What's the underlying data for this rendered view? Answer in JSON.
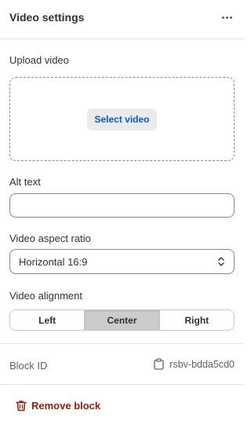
{
  "header": {
    "title": "Video settings",
    "more_icon": "more-horizontal-icon"
  },
  "upload": {
    "label": "Upload video",
    "button_label": "Select video"
  },
  "alt_text": {
    "label": "Alt text",
    "value": "",
    "placeholder": ""
  },
  "aspect_ratio": {
    "label": "Video aspect ratio",
    "selected": "Horizontal 16:9",
    "icon": "select-chevron-icon"
  },
  "alignment": {
    "label": "Video alignment",
    "options": [
      "Left",
      "Center",
      "Right"
    ],
    "selected": "Center"
  },
  "block_id": {
    "label": "Block ID",
    "value": "rsbv-bdda5cd0",
    "icon": "clipboard-icon"
  },
  "remove": {
    "label": "Remove block",
    "icon": "trash-icon"
  },
  "colors": {
    "link": "#005bd3",
    "critical": "#8e1f0b",
    "border": "#8a8a8a",
    "selected_segment": "#cccccc"
  }
}
